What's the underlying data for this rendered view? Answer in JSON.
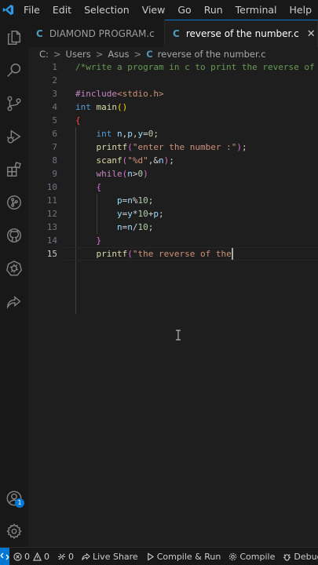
{
  "menu": [
    "File",
    "Edit",
    "Selection",
    "View",
    "Go",
    "Run",
    "Terminal",
    "Help"
  ],
  "tabs": [
    {
      "label": "DIAMOND PROGRAM.c",
      "glyph": "C"
    },
    {
      "label": "reverse of the number.c",
      "glyph": "C",
      "close": "✕"
    }
  ],
  "breadcrumb": {
    "parts": [
      "C:",
      "Users",
      "Asus"
    ],
    "separator": ">",
    "file_glyph": "C",
    "file": "reverse of the number.c"
  },
  "editor": {
    "current_line": 15,
    "lines": [
      {
        "n": "1",
        "tokens": [
          {
            "c": "comment",
            "t": "/*write a program in c to print the reverse of the number*/"
          }
        ]
      },
      {
        "n": "2",
        "tokens": []
      },
      {
        "n": "3",
        "tokens": [
          {
            "c": "pre",
            "t": "#include"
          },
          {
            "c": "str",
            "t": "<stdio.h>"
          }
        ]
      },
      {
        "n": "4",
        "tokens": [
          {
            "c": "type",
            "t": "int"
          },
          {
            "c": "punc",
            "t": " "
          },
          {
            "c": "func",
            "t": "main"
          },
          {
            "c": "paren",
            "t": "()"
          }
        ]
      },
      {
        "n": "5",
        "tokens": [
          {
            "c": "brace-err",
            "t": "{"
          }
        ]
      },
      {
        "n": "6",
        "tokens": [
          {
            "c": "punc",
            "t": "    "
          },
          {
            "c": "type",
            "t": "int"
          },
          {
            "c": "punc",
            "t": " "
          },
          {
            "c": "var",
            "t": "n"
          },
          {
            "c": "punc",
            "t": ","
          },
          {
            "c": "var",
            "t": "p"
          },
          {
            "c": "punc",
            "t": ","
          },
          {
            "c": "var",
            "t": "y"
          },
          {
            "c": "punc",
            "t": "="
          },
          {
            "c": "num",
            "t": "0"
          },
          {
            "c": "punc",
            "t": ";"
          }
        ]
      },
      {
        "n": "7",
        "tokens": [
          {
            "c": "punc",
            "t": "    "
          },
          {
            "c": "func",
            "t": "printf"
          },
          {
            "c": "brace",
            "t": "("
          },
          {
            "c": "str",
            "t": "\"enter the number :\""
          },
          {
            "c": "brace",
            "t": ")"
          },
          {
            "c": "punc",
            "t": ";"
          }
        ]
      },
      {
        "n": "8",
        "tokens": [
          {
            "c": "punc",
            "t": "    "
          },
          {
            "c": "func",
            "t": "scanf"
          },
          {
            "c": "brace",
            "t": "("
          },
          {
            "c": "str",
            "t": "\"%d\""
          },
          {
            "c": "punc",
            "t": ",&"
          },
          {
            "c": "var",
            "t": "n"
          },
          {
            "c": "brace",
            "t": ")"
          },
          {
            "c": "punc",
            "t": ";"
          }
        ]
      },
      {
        "n": "9",
        "tokens": [
          {
            "c": "punc",
            "t": "    "
          },
          {
            "c": "kw",
            "t": "while"
          },
          {
            "c": "brace",
            "t": "("
          },
          {
            "c": "var",
            "t": "n"
          },
          {
            "c": "punc",
            "t": ">"
          },
          {
            "c": "num",
            "t": "0"
          },
          {
            "c": "brace",
            "t": ")"
          }
        ]
      },
      {
        "n": "10",
        "tokens": [
          {
            "c": "punc",
            "t": "    "
          },
          {
            "c": "brace",
            "t": "{"
          }
        ]
      },
      {
        "n": "11",
        "tokens": [
          {
            "c": "punc",
            "t": "        "
          },
          {
            "c": "var",
            "t": "p"
          },
          {
            "c": "punc",
            "t": "="
          },
          {
            "c": "var",
            "t": "n"
          },
          {
            "c": "punc",
            "t": "%"
          },
          {
            "c": "num",
            "t": "10"
          },
          {
            "c": "punc",
            "t": ";"
          }
        ]
      },
      {
        "n": "12",
        "tokens": [
          {
            "c": "punc",
            "t": "        "
          },
          {
            "c": "var",
            "t": "y"
          },
          {
            "c": "punc",
            "t": "="
          },
          {
            "c": "var",
            "t": "y"
          },
          {
            "c": "punc",
            "t": "*"
          },
          {
            "c": "num",
            "t": "10"
          },
          {
            "c": "punc",
            "t": "+"
          },
          {
            "c": "var",
            "t": "p"
          },
          {
            "c": "punc",
            "t": ";"
          }
        ]
      },
      {
        "n": "13",
        "tokens": [
          {
            "c": "punc",
            "t": "        "
          },
          {
            "c": "var",
            "t": "n"
          },
          {
            "c": "punc",
            "t": "="
          },
          {
            "c": "var",
            "t": "n"
          },
          {
            "c": "punc",
            "t": "/"
          },
          {
            "c": "num",
            "t": "10"
          },
          {
            "c": "punc",
            "t": ";"
          }
        ]
      },
      {
        "n": "14",
        "tokens": [
          {
            "c": "punc",
            "t": "    "
          },
          {
            "c": "brace",
            "t": "}"
          }
        ]
      },
      {
        "n": "15",
        "tokens": [
          {
            "c": "punc",
            "t": "    "
          },
          {
            "c": "func",
            "t": "printf"
          },
          {
            "c": "brace",
            "t": "("
          },
          {
            "c": "str",
            "t": "\"the reverse of the"
          }
        ]
      }
    ]
  },
  "statusbar": {
    "errors": "0",
    "warnings": "0",
    "ports": "0",
    "live_share": "Live Share",
    "compile_run": "Compile & Run",
    "compile": "Compile",
    "debug": "Debug"
  },
  "accounts_badge": "1",
  "colors": {
    "accent": "#0078d4",
    "background": "#1e1e1e",
    "chrome": "#181818"
  }
}
